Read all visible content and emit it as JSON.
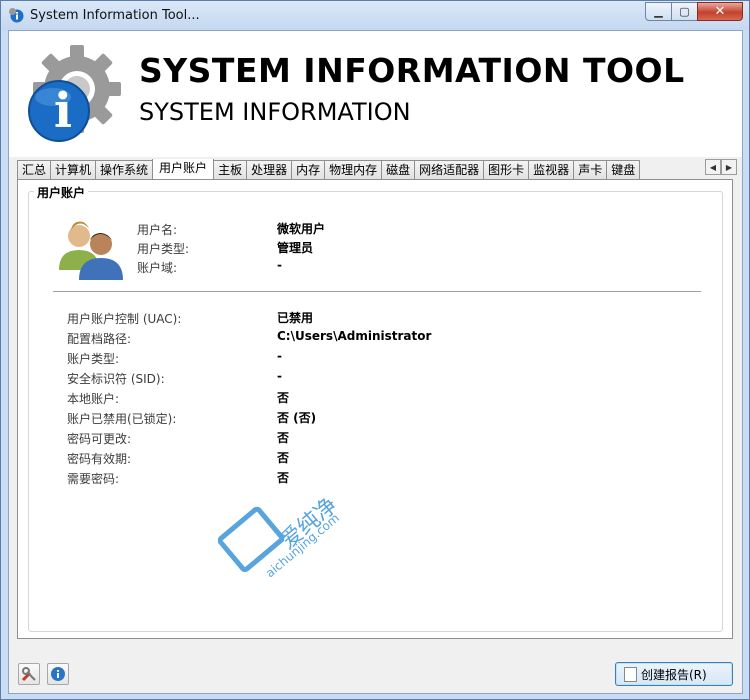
{
  "window": {
    "title": "System Information Tool...",
    "min_label": "▁",
    "max_label": "▢",
    "close_label": "✕"
  },
  "banner": {
    "title": "SYSTEM INFORMATION TOOL",
    "subtitle": "SYSTEM INFORMATION",
    "logo_glyph": "i"
  },
  "tabs": [
    "汇总",
    "计算机",
    "操作系统",
    "用户账户",
    "主板",
    "处理器",
    "内存",
    "物理内存",
    "磁盘",
    "网络适配器",
    "图形卡",
    "监视器",
    "声卡",
    "键盘"
  ],
  "active_tab_index": 3,
  "tab_scroll": {
    "left": "◀",
    "right": "▶"
  },
  "section": {
    "legend": "用户账户",
    "top_props": [
      {
        "label": "用户名:",
        "value": "微软用户"
      },
      {
        "label": "用户类型:",
        "value": "管理员"
      },
      {
        "label": "账户域:",
        "value": "-"
      }
    ],
    "detail_props": [
      {
        "label": "用户账户控制 (UAC):",
        "value": "已禁用"
      },
      {
        "label": "配置档路径:",
        "value": "C:\\Users\\Administrator"
      },
      {
        "label": "账户类型:",
        "value": "-"
      },
      {
        "label": "安全标识符 (SID):",
        "value": "-"
      },
      {
        "label": "本地账户:",
        "value": "否"
      },
      {
        "label": "账户已禁用(已锁定):",
        "value": "否 (否)"
      },
      {
        "label": "密码可更改:",
        "value": "否"
      },
      {
        "label": "密码有效期:",
        "value": "否"
      },
      {
        "label": "需要密码:",
        "value": "否"
      }
    ]
  },
  "watermark": {
    "text": "爱纯净",
    "url": "aichunjing.com"
  },
  "footer": {
    "report_button": "创建报告(R)"
  },
  "colors": {
    "frame": "#c9dcf3",
    "accent_blue": "#1f6fc5",
    "close_red": "#c4412f"
  }
}
